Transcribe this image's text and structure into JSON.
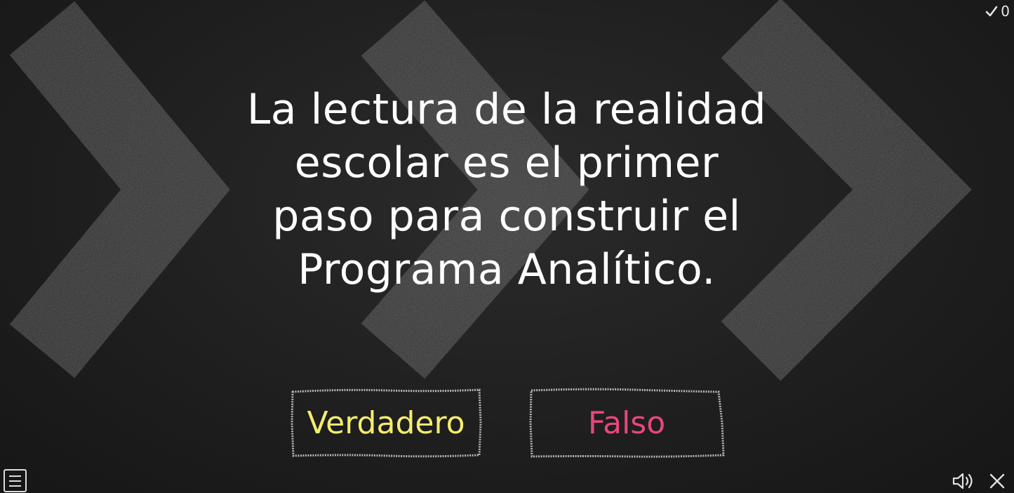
{
  "score": {
    "icon": "check-icon",
    "value": "0"
  },
  "question": {
    "lines": [
      "La lectura de la realidad",
      "escolar es el primer",
      "paso para construir el",
      "Programa Analítico."
    ]
  },
  "answers": {
    "true_label": "Verdadero",
    "false_label": "Falso",
    "true_color": "#f5ec6e",
    "false_color": "#e8467f"
  },
  "controls": {
    "menu_icon": "hamburger-menu-icon",
    "sound_icon": "speaker-icon",
    "close_icon": "close-icon"
  },
  "colors": {
    "background": "#1d1d1d",
    "text": "#ffffff"
  }
}
